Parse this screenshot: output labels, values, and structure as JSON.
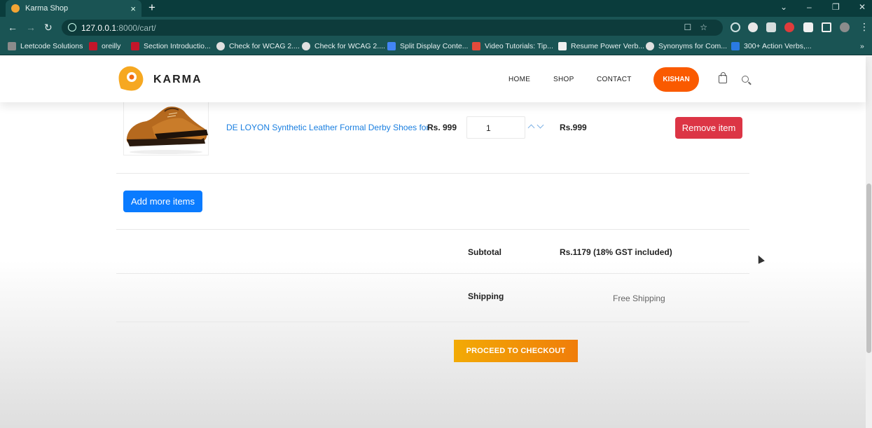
{
  "browser": {
    "tab_title": "Karma Shop",
    "tab_close": "×",
    "new_tab": "+",
    "url_host": "127.0.0.1",
    "url_path": ":8000/cart/",
    "window_controls": [
      "⌄",
      "–",
      "❐",
      "✕"
    ]
  },
  "bookmarks": [
    {
      "label": "Leetcode Solutions",
      "icon_color": "#8b8b8b"
    },
    {
      "label": "oreilly",
      "icon_color": "#c4162a"
    },
    {
      "label": "Section Introductio...",
      "icon_color": "#c4162a"
    },
    {
      "label": "Check for WCAG 2....",
      "icon_color": "#e0e0e0"
    },
    {
      "label": "Check for WCAG 2....",
      "icon_color": "#e0e0e0"
    },
    {
      "label": "Split Display Conte...",
      "icon_color": "#4285f4"
    },
    {
      "label": "Video Tutorials: Tip...",
      "icon_color": "#e24a3b"
    },
    {
      "label": "Resume Power Verb...",
      "icon_color": "#f0f0f0"
    },
    {
      "label": "Synonyms for Com...",
      "icon_color": "#e0e0e0"
    },
    {
      "label": "300+ Action Verbs,...",
      "icon_color": "#2a7ae2"
    }
  ],
  "header": {
    "brand": "KARMA",
    "nav": [
      "HOME",
      "SHOP",
      "CONTACT"
    ],
    "user": "KISHAN"
  },
  "cart": {
    "item": {
      "name": "DE LOYON Synthetic Leather Formal Derby Shoes for",
      "price": "Rs. 999",
      "quantity": "1",
      "total": "Rs.999",
      "remove_label": "Remove item"
    },
    "add_more_label": "Add more items",
    "subtotal_label": "Subtotal",
    "subtotal_value": "Rs.1179 (18% GST included)",
    "shipping_label": "Shipping",
    "shipping_value": "Free Shipping",
    "checkout_label": "PROCEED TO CHECKOUT"
  },
  "colors": {
    "accent_orange": "#fa5a00",
    "remove_red": "#dc3545",
    "add_blue": "#0a7bff",
    "checkout_start": "#f2aa05",
    "checkout_end": "#f07d0a",
    "browser_teal": "#1a5454"
  }
}
